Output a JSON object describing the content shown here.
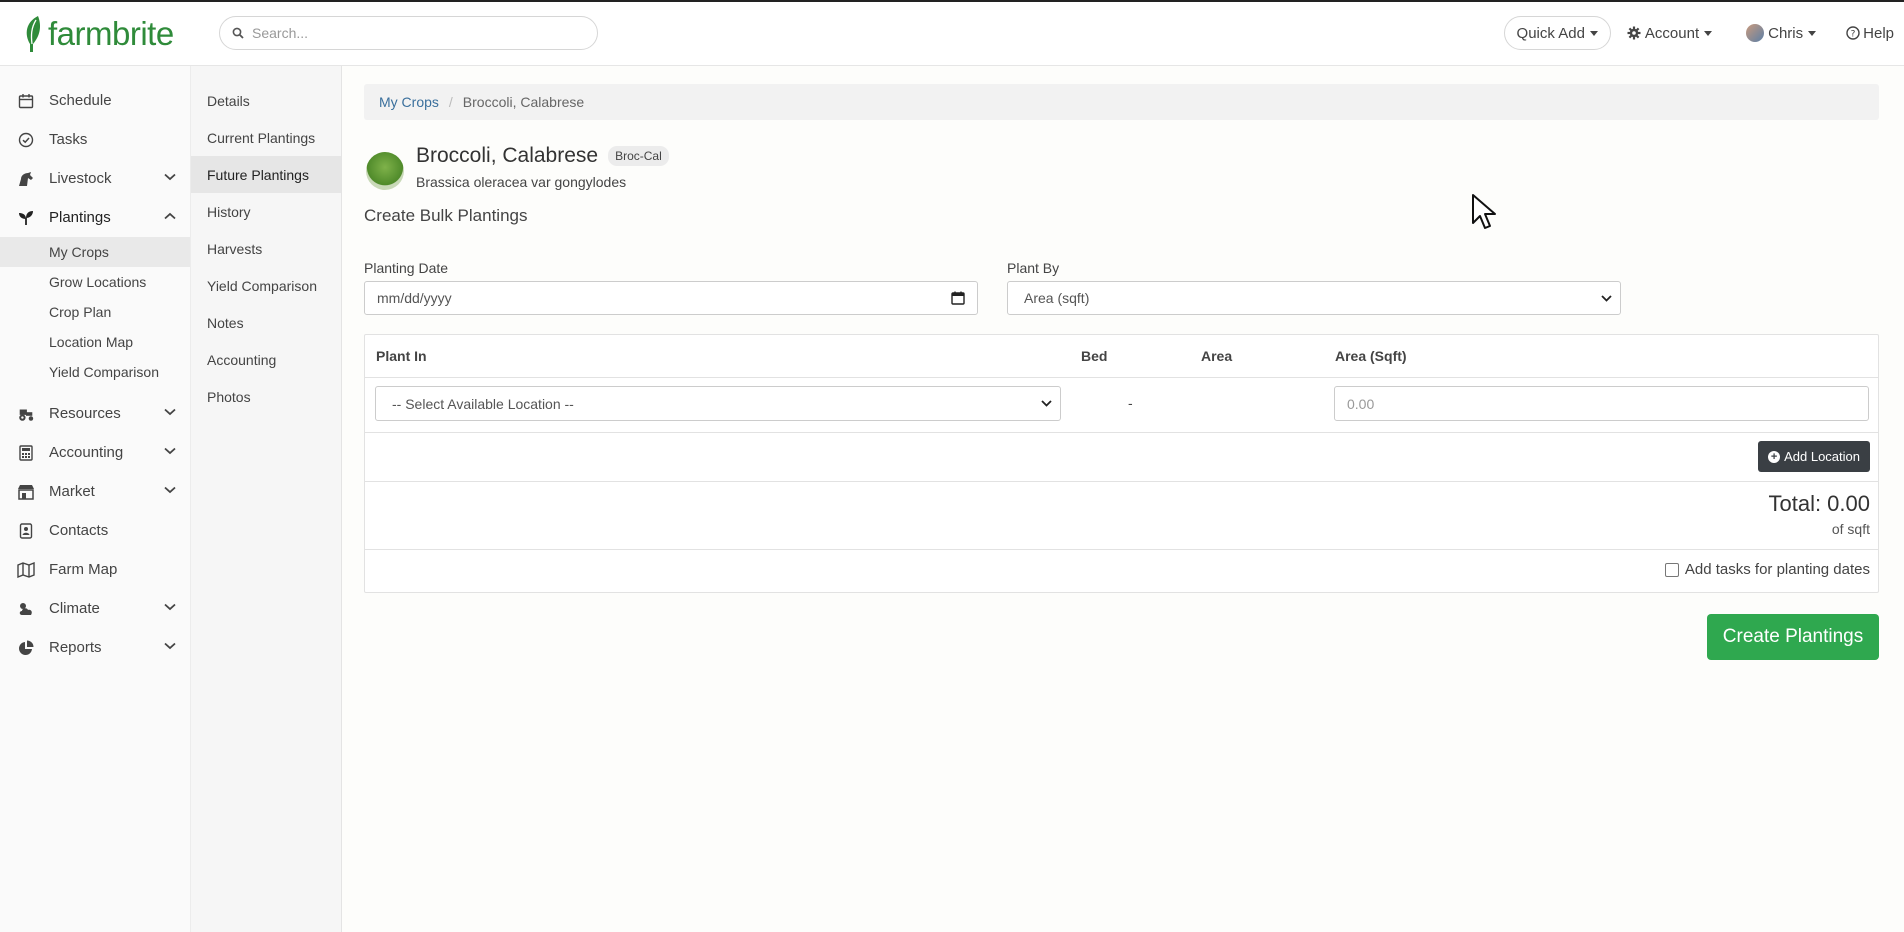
{
  "header": {
    "logo_text": "farmbrite",
    "search_placeholder": "Search...",
    "quick_add": "Quick Add",
    "account": "Account",
    "user": "Chris",
    "help": "Help"
  },
  "sidebar": {
    "items": [
      {
        "label": "Schedule",
        "icon": "calendar-icon"
      },
      {
        "label": "Tasks",
        "icon": "check-circle-icon"
      },
      {
        "label": "Livestock",
        "icon": "horse-icon"
      },
      {
        "label": "Plantings",
        "icon": "seedling-icon"
      },
      {
        "label": "Resources",
        "icon": "tractor-icon"
      },
      {
        "label": "Accounting",
        "icon": "calculator-icon"
      },
      {
        "label": "Market",
        "icon": "store-icon"
      },
      {
        "label": "Contacts",
        "icon": "address-book-icon"
      },
      {
        "label": "Farm Map",
        "icon": "map-icon"
      },
      {
        "label": "Climate",
        "icon": "cloud-sun-icon"
      },
      {
        "label": "Reports",
        "icon": "pie-chart-icon"
      }
    ],
    "plantings_sub": [
      "My Crops",
      "Grow Locations",
      "Crop Plan",
      "Location Map",
      "Yield Comparison"
    ]
  },
  "subnav": [
    "Details",
    "Current Plantings",
    "Future Plantings",
    "History",
    "Harvests",
    "Yield Comparison",
    "Notes",
    "Accounting",
    "Photos"
  ],
  "breadcrumb": {
    "link": "My Crops",
    "sep": "/",
    "current": "Broccoli, Calabrese"
  },
  "crop": {
    "name": "Broccoli, Calabrese",
    "badge": "Broc-Cal",
    "scientific": "Brassica oleracea var gongylodes"
  },
  "form": {
    "section_title": "Create Bulk Plantings",
    "planting_date_label": "Planting Date",
    "planting_date_placeholder": "mm/dd/yyyy",
    "plant_by_label": "Plant By",
    "plant_by_value": "Area (sqft)"
  },
  "table": {
    "headers": [
      "Plant In",
      "Bed",
      "Area",
      "Area (Sqft)"
    ],
    "location_select": "-- Select Available Location --",
    "bed_value": "-",
    "area_sqft_placeholder": "0.00",
    "add_location": "Add Location",
    "total": "Total: 0.00",
    "total_unit": "of sqft",
    "add_tasks_label": "Add tasks for planting dates"
  },
  "create_button": "Create Plantings",
  "colors": {
    "brand_green": "#2f8b3a",
    "create_green": "#2fa84f",
    "dark_button": "#3a3f44",
    "link_blue": "#3a6f9c"
  }
}
